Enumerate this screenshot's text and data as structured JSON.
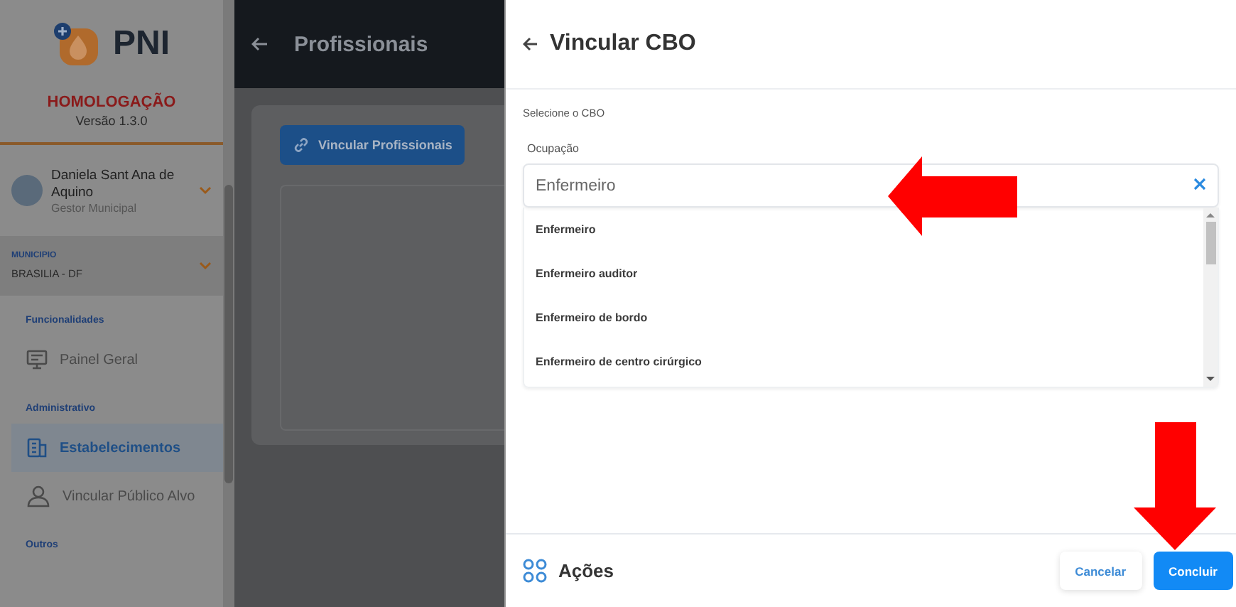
{
  "sidebar": {
    "logo_text": "PNI",
    "environment": "HOMOLOGAÇÃO",
    "version": "Versão 1.3.0",
    "user": {
      "name": "Daniela Sant Ana de Aquino",
      "role": "Gestor Municipal"
    },
    "municipality": {
      "label": "MUNICIPIO",
      "value": "BRASILIA - DF"
    },
    "sections": [
      {
        "title": "Funcionalidades",
        "items": [
          {
            "label": "Painel Geral",
            "kind": "monitor",
            "selected": false
          }
        ]
      },
      {
        "title": "Administrativo",
        "items": [
          {
            "label": "Estabelecimentos",
            "kind": "building",
            "selected": true
          },
          {
            "label": "Vincular Público Alvo",
            "kind": "person",
            "selected": false
          }
        ]
      },
      {
        "title": "Outros"
      }
    ]
  },
  "header": {
    "title": "Profissionais"
  },
  "content": {
    "button": "Vincular Profissionais"
  },
  "dialog": {
    "title": "Vincular CBO",
    "section_label": "Selecione o CBO",
    "field": {
      "label": "Ocupação",
      "value": "Enfermeiro"
    },
    "options": [
      "Enfermeiro",
      "Enfermeiro auditor",
      "Enfermeiro de bordo",
      "Enfermeiro de centro cirúrgico"
    ],
    "footer": {
      "title": "Ações",
      "buttons": [
        {
          "label": "Cancelar",
          "kind": "secondary"
        },
        {
          "label": "Concluir",
          "kind": "primary"
        }
      ]
    }
  }
}
